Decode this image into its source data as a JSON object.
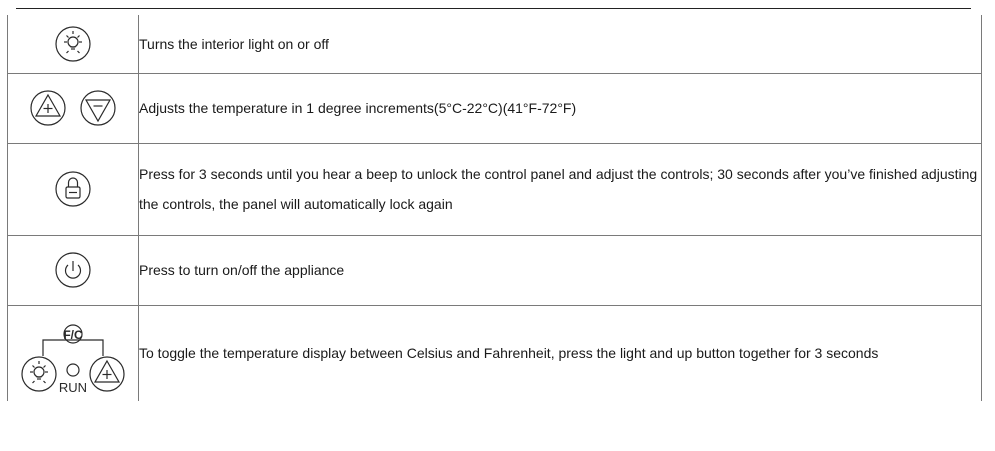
{
  "rows": [
    {
      "icon": "light-bulb-icon",
      "text": "Turns the interior light on or off"
    },
    {
      "icon": "up-down-arrows-icon",
      "text": "Adjusts the temperature in 1 degree increments(5°C-22°C)(41°F-72°F)"
    },
    {
      "icon": "lock-icon",
      "text": "Press for 3 seconds until you hear a beep to unlock the control panel and adjust the controls; 30 seconds after you’ve finished adjusting the controls, the panel will automatically lock again"
    },
    {
      "icon": "power-icon",
      "text": "Press to turn on/off the appliance"
    },
    {
      "icon": "celsius-fahrenheit-combo-icon",
      "text": "To toggle the temperature display between Celsius and Fahrenheit, press the light and up button together for 3 seconds",
      "run_label": "RUN"
    }
  ]
}
